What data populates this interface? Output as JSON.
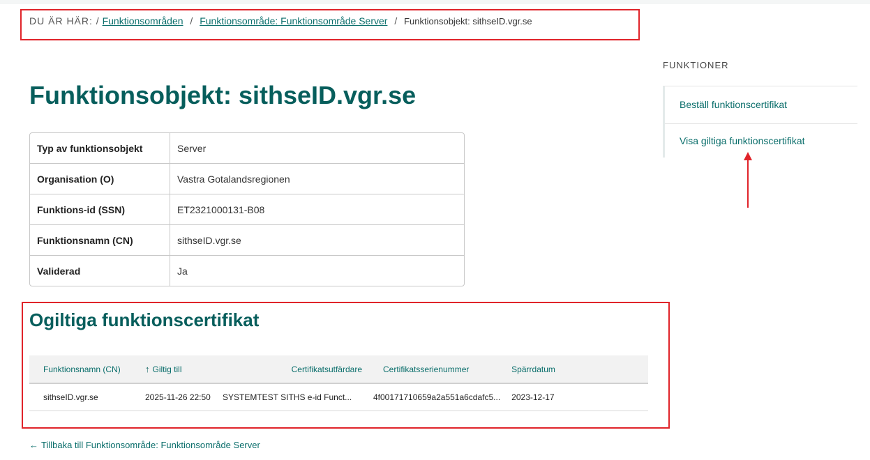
{
  "breadcrumb": {
    "lead": "DU ÄR HÄR: /",
    "link1": "Funktionsområden",
    "link2": "Funktionsområde: Funktionsområde Server",
    "current": "Funktionsobjekt: sithseID.vgr.se",
    "separator": "/"
  },
  "title": "Funktionsobjekt: sithseID.vgr.se",
  "info": {
    "rows": [
      {
        "key": "Typ av funktionsobjekt",
        "value": "Server"
      },
      {
        "key": "Organisation (O)",
        "value": "Vastra Gotalandsregionen"
      },
      {
        "key": "Funktions-id (SSN)",
        "value": "ET2321000131-B08"
      },
      {
        "key": "Funktionsnamn (CN)",
        "value": "sithseID.vgr.se"
      },
      {
        "key": "Validerad",
        "value": "Ja"
      }
    ]
  },
  "invalid_certs": {
    "title": "Ogiltiga funktionscertifikat",
    "headers": {
      "name": "Funktionsnamn (CN)",
      "sort_icon": "↑",
      "valid_to": "Giltig till",
      "issuer": "Certifikatsutfärdare",
      "serial": "Certifikatsserienummer",
      "revoked": "Spärrdatum"
    },
    "rows": [
      {
        "name": "sithseID.vgr.se",
        "valid_to": "2025-11-26 22:50",
        "issuer": "SYSTEMTEST SITHS e-id Funct...",
        "serial": "4f00171710659a2a551a6cdafc5...",
        "revoked": "2023-12-17"
      }
    ]
  },
  "back_link": {
    "arrow": "←",
    "label": "Tillbaka till Funktionsområde: Funktionsområde Server"
  },
  "sidebar": {
    "heading": "FUNKTIONER",
    "items": [
      {
        "label": "Beställ funktionscertifikat"
      },
      {
        "label": "Visa giltiga funktionscertifikat"
      }
    ]
  },
  "colors": {
    "accent": "#075e5c",
    "link": "#0a6e6b",
    "annotation": "#e0242a"
  }
}
